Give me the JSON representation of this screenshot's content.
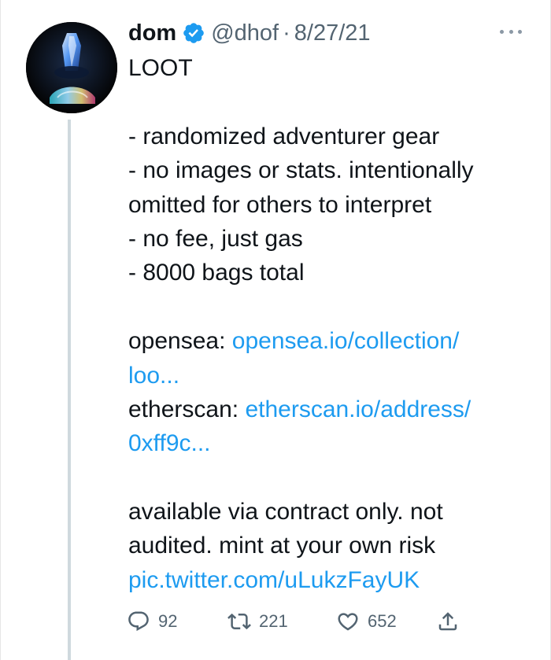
{
  "tweet": {
    "author": {
      "display_name": "dom",
      "handle": "@dhof",
      "verified": true,
      "avatar_icon": "prism-crystal-avatar"
    },
    "separator": "·",
    "date": "8/27/21",
    "more_icon": "ellipsis-icon",
    "body": {
      "title": "LOOT",
      "bullets": [
        "- randomized adventurer gear",
        "- no images or stats. intentionally",
        "omitted for others to interpret",
        "- no fee, just gas",
        "- 8000 bags total"
      ],
      "opensea_label": "opensea:",
      "opensea_link_part1": "opensea.io/collection/",
      "opensea_link_part2": "loo...",
      "etherscan_label": "etherscan:",
      "etherscan_link_part1": "etherscan.io/address/",
      "etherscan_link_part2": "0xff9c...",
      "closing_line1": "available via contract only. not",
      "closing_line2": "audited. mint at your own risk",
      "pic_link": "pic.twitter.com/uLukzFayUK"
    },
    "actions": {
      "reply_count": "92",
      "retweet_count": "221",
      "like_count": "652"
    },
    "colors": {
      "link": "#1d9bf0",
      "verified": "#1d9bf0",
      "secondary_text": "#536471",
      "thread_line": "#cfd9de"
    }
  }
}
